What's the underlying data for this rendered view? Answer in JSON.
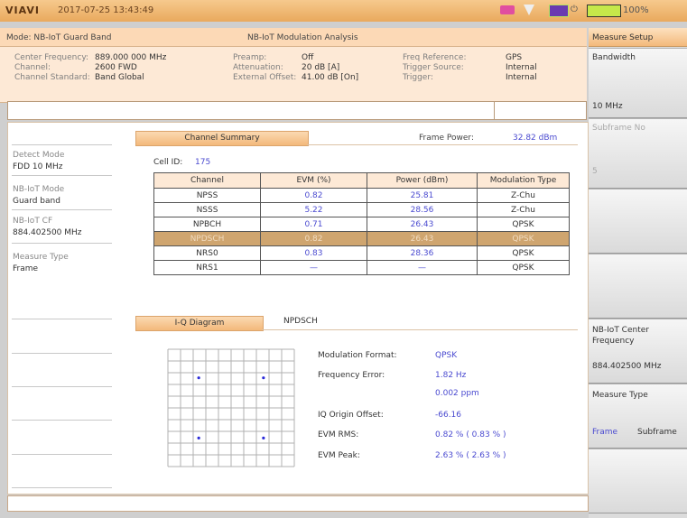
{
  "status_bar": {
    "brand": "VIAVI",
    "datetime": "2017-07-25  13:43:49",
    "battery_label": "100%"
  },
  "header": {
    "mode": "Mode: NB-IoT Guard Band",
    "analysis_title": "NB-IoT Modulation Analysis"
  },
  "settings": {
    "col1": [
      {
        "label": "Center Frequency:",
        "value": "889.000 000 MHz"
      },
      {
        "label": "Channel:",
        "value": "2600 FWD"
      },
      {
        "label": "Channel Standard:",
        "value": "Band Global"
      }
    ],
    "col2": [
      {
        "label": "Preamp:",
        "value": "Off"
      },
      {
        "label": "Attenuation:",
        "value": "20 dB [A]"
      },
      {
        "label": "External Offset:",
        "value": "41.00 dB [On]"
      }
    ],
    "col3": [
      {
        "label": "Freq Reference:",
        "value": "GPS"
      },
      {
        "label": "Trigger Source:",
        "value": "Internal"
      },
      {
        "label": "Trigger:",
        "value": "Internal"
      }
    ]
  },
  "sidebar": {
    "items": [
      {
        "label": "Detect Mode",
        "value": "FDD 10 MHz"
      },
      {
        "label": "NB-IoT Mode",
        "value": "Guard band"
      },
      {
        "label": "NB-IoT CF",
        "value": "884.402500 MHz"
      },
      {
        "label": "Measure Type",
        "value": "Frame"
      }
    ]
  },
  "summary": {
    "tab_label": "Channel Summary",
    "frame_power_label": "Frame Power:",
    "frame_power_value": "32.82 dBm",
    "cell_id_label": "Cell ID:",
    "cell_id_value": "175",
    "columns": [
      "Channel",
      "EVM (%)",
      "Power (dBm)",
      "Modulation Type"
    ],
    "rows": [
      [
        "NPSS",
        "0.82",
        "25.81",
        "Z-Chu"
      ],
      [
        "NSSS",
        "5.22",
        "28.56",
        "Z-Chu"
      ],
      [
        "NPBCH",
        "0.71",
        "26.43",
        "QPSK"
      ],
      [
        "NPDSCH",
        "0.82",
        "26.43",
        "QPSK"
      ],
      [
        "NRS0",
        "0.83",
        "28.36",
        "QPSK"
      ],
      [
        "NRS1",
        "—",
        "—",
        "QPSK"
      ]
    ],
    "selected_row": 3
  },
  "iq": {
    "tab_label": "I-Q Diagram",
    "channel_label": "NPDSCH",
    "metrics": [
      {
        "label": "Modulation Format:",
        "value": "QPSK"
      },
      {
        "label": "Frequency Error:",
        "value": "1.82 Hz"
      },
      {
        "label": "",
        "value": "0.002 ppm"
      },
      {
        "label": "IQ Origin Offset:",
        "value": "-66.16"
      },
      {
        "label": "EVM RMS:",
        "value": "0.82 % ( 0.83 % )"
      },
      {
        "label": "EVM Peak:",
        "value": "2.63 % ( 2.63 % )"
      }
    ]
  },
  "right_panel": {
    "title": "Measure Setup",
    "bandwidth_label": "Bandwidth",
    "bandwidth_value": "10 MHz",
    "subframe_label": "Subframe No",
    "subframe_value": "5",
    "nbiot_cf_label": "NB-IoT Center Frequency",
    "nbiot_cf_value": "884.402500 MHz",
    "measure_type_label": "Measure Type",
    "measure_type_opt1": "Frame",
    "measure_type_opt2": "Subframe"
  },
  "colors": {
    "accent": "#f2b46f",
    "value_blue": "#4a4ad0",
    "selected_row": "#cfa56f"
  }
}
